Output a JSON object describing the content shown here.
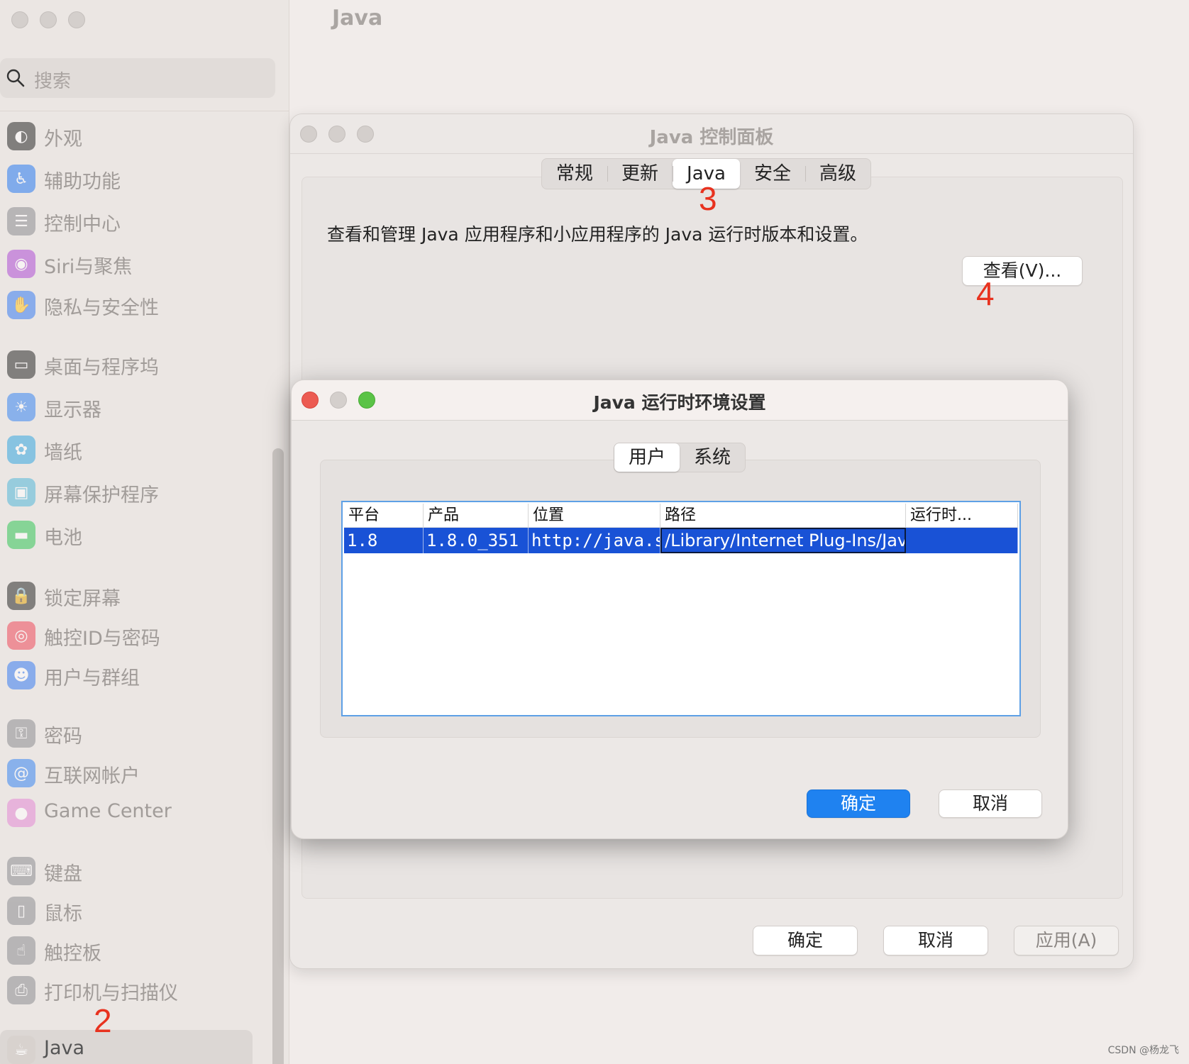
{
  "main_title": "Java",
  "sidebar": {
    "search_placeholder": "搜索",
    "items": [
      {
        "label": "外观",
        "icon": "appearance-icon",
        "color": "#2b2b2b"
      },
      {
        "label": "辅助功能",
        "icon": "accessibility-icon",
        "color": "#2a7cf2"
      },
      {
        "label": "控制中心",
        "icon": "control-center-icon",
        "color": "#8e8e93"
      },
      {
        "label": "Siri与聚焦",
        "icon": "siri-icon",
        "color": "#b04fd6"
      },
      {
        "label": "隐私与安全性",
        "icon": "hand-icon",
        "color": "#3a7ef2"
      },
      {
        "label": "桌面与程序坞",
        "icon": "dock-icon",
        "color": "#2b2b2b"
      },
      {
        "label": "显示器",
        "icon": "display-icon",
        "color": "#3a86f2"
      },
      {
        "label": "墙纸",
        "icon": "wallpaper-icon",
        "color": "#36a8e0"
      },
      {
        "label": "屏幕保护程序",
        "icon": "screensaver-icon",
        "color": "#53b7d9"
      },
      {
        "label": "电池",
        "icon": "battery-icon",
        "color": "#35c759"
      },
      {
        "label": "锁定屏幕",
        "icon": "lock-icon",
        "color": "#2b2b2b"
      },
      {
        "label": "触控ID与密码",
        "icon": "fingerprint-icon",
        "color": "#ef4b5c"
      },
      {
        "label": "用户与群组",
        "icon": "users-icon",
        "color": "#3a7ef2"
      },
      {
        "label": "密码",
        "icon": "key-icon",
        "color": "#8e8e93"
      },
      {
        "label": "互联网帐户",
        "icon": "at-icon",
        "color": "#3a86f2"
      },
      {
        "label": "Game Center",
        "icon": "game-center-icon",
        "color": "#e58ad6"
      },
      {
        "label": "键盘",
        "icon": "keyboard-icon",
        "color": "#8e8e93"
      },
      {
        "label": "鼠标",
        "icon": "mouse-icon",
        "color": "#8e8e93"
      },
      {
        "label": "触控板",
        "icon": "trackpad-icon",
        "color": "#8e8e93"
      },
      {
        "label": "打印机与扫描仪",
        "icon": "printer-icon",
        "color": "#8e8e93"
      },
      {
        "label": "Java",
        "icon": "java-icon",
        "color": "#d8d2ce"
      }
    ]
  },
  "annotations": {
    "n2": "2",
    "n3": "3",
    "n4": "4"
  },
  "control_panel": {
    "title": "Java 控制面板",
    "tabs": [
      "常规",
      "更新",
      "Java",
      "安全",
      "高级"
    ],
    "active_tab": "Java",
    "description": "查看和管理 Java 应用程序和小应用程序的 Java 运行时版本和设置。",
    "view_button": "查看(V)...",
    "ok": "确定",
    "cancel": "取消",
    "apply": "应用(A)"
  },
  "jre_dialog": {
    "title": "Java 运行时环境设置",
    "tabs": [
      "用户",
      "系统"
    ],
    "active_tab": "用户",
    "columns": [
      "平台",
      "产品",
      "位置",
      "路径",
      "运行时..."
    ],
    "rows": [
      [
        "1.8",
        "1.8.0_351",
        "http://java.su...",
        "/Library/Internet Plug-Ins/Jav...",
        ""
      ]
    ],
    "ok": "确定",
    "cancel": "取消",
    "accent": "#1f82f0",
    "selection_color": "#1952d6"
  },
  "watermark": "CSDN @杨龙飞"
}
